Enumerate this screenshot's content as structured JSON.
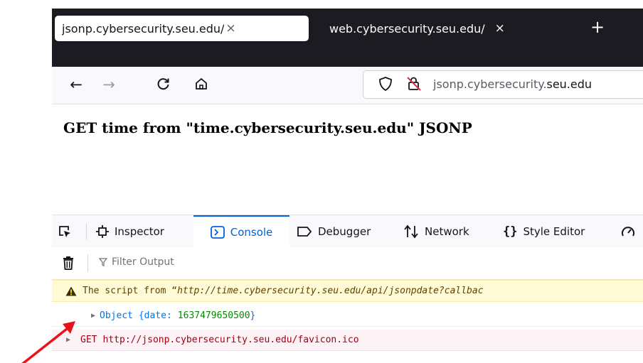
{
  "browser": {
    "tabs": [
      {
        "title": "jsonp.cybersecurity.seu.edu/",
        "close": "×",
        "active": true
      },
      {
        "title": "web.cybersecurity.seu.edu/",
        "close": "×",
        "active": false
      }
    ],
    "new_tab": "+",
    "nav": {
      "back": "←",
      "forward": "→",
      "reload": "C",
      "home": "⌂"
    },
    "url": {
      "prefix": "jsonp.cybersecurity.",
      "domain": "seu.edu"
    }
  },
  "page": {
    "heading": "GET time from \"time.cybersecurity.seu.edu\" JSONP"
  },
  "devtools": {
    "tabs": [
      {
        "label": "Inspector",
        "icon": "inspector-icon"
      },
      {
        "label": "Console",
        "icon": "console-icon",
        "selected": true
      },
      {
        "label": "Debugger",
        "icon": "debugger-icon"
      },
      {
        "label": "Network",
        "icon": "network-icon"
      },
      {
        "label": "Style Editor",
        "icon": "style-editor-icon"
      }
    ],
    "filter_placeholder": "Filter Output",
    "messages": {
      "warning": {
        "text_prefix": "The script from “",
        "url": "http://time.cybersecurity.seu.edu/api/jsonpdate?callbac"
      },
      "log": {
        "object_label": "Object { ",
        "key": "date:",
        "value": "1637479650500",
        "close": " }"
      },
      "error": {
        "method": "GET",
        "url": "http://jsonp.cybersecurity.seu.edu/favicon.ico"
      }
    }
  },
  "colors": {
    "annotation_arrow": "#e8121b",
    "accent": "#0060df"
  }
}
